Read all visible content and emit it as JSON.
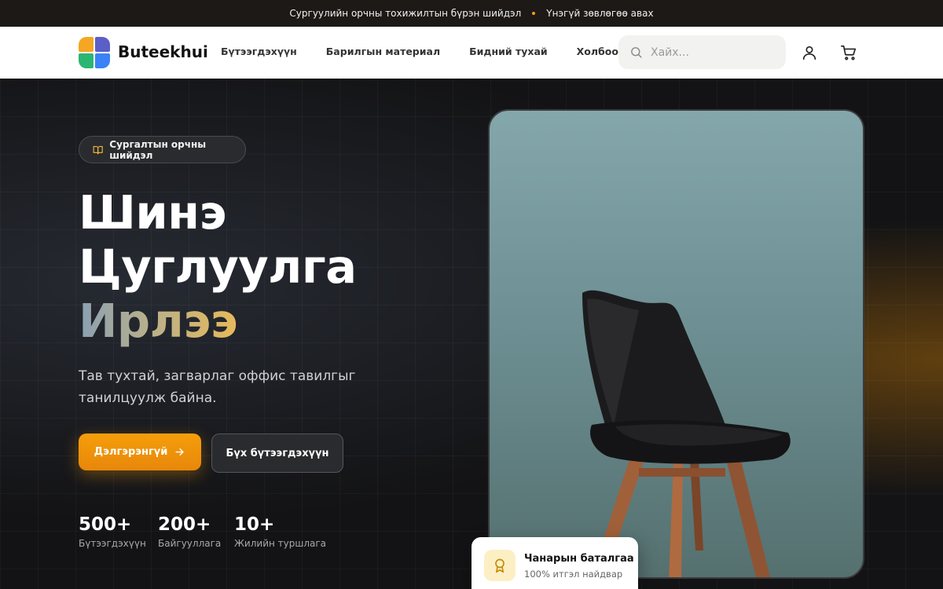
{
  "topbar": {
    "text_left": "Сургуулийн орчны тохижилтын бүрэн шийдэл",
    "text_right": "Үнэгүй зөвлөгөө авах"
  },
  "header": {
    "brand": "Buteekhui",
    "nav": [
      {
        "label": "Бүтээгдэхүүн"
      },
      {
        "label": "Барилгын материал"
      },
      {
        "label": "Бидний тухай"
      },
      {
        "label": "Холбоо барих"
      }
    ],
    "search_placeholder": "Хайх..."
  },
  "hero": {
    "badge": "Сургалтын орчны шийдэл",
    "headline_line1": "Шинэ",
    "headline_line2": "Цуглуулга",
    "headline_line3": "Ирлээ",
    "subtitle": "Тав тухтай, загварлаг оффис тавилгыг танилцуулж байна.",
    "cta_primary": "Дэлгэрэнгүй",
    "cta_secondary": "Бүх бүтээгдэхүүн",
    "stats": [
      {
        "value": "500+",
        "label": "Бүтээгдэхүүн"
      },
      {
        "value": "200+",
        "label": "Байгууллага"
      },
      {
        "value": "10+",
        "label": "Жилийн туршлага"
      }
    ],
    "quality_card": {
      "title": "Чанарын баталгаа",
      "subtitle": "100% итгэл найдвар"
    }
  },
  "colors": {
    "accent": "#f59e0b",
    "dark_bg": "#131315"
  },
  "icons": {
    "badge": "book-open-icon",
    "search": "search-icon",
    "account": "user-icon",
    "cart": "cart-icon",
    "cta": "arrow-right-icon",
    "quality": "award-icon"
  }
}
